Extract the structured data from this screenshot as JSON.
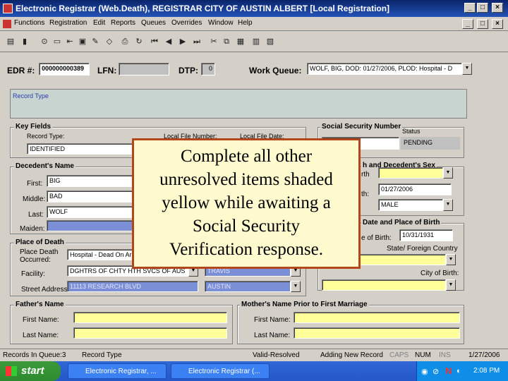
{
  "window": {
    "title": "Electronic Registrar (Web.Death), REGISTRAR   CITY OF AUSTIN   ALBERT   [Local Registration]"
  },
  "menu": [
    "Functions",
    "Registration",
    "Edit",
    "Reports",
    "Queues",
    "Overrides",
    "Window",
    "Help"
  ],
  "header": {
    "edr_label": "EDR #:",
    "edr_value": "000000000389",
    "lfn_label": "LFN:",
    "lfn_value": "",
    "dtp_label": "DTP:",
    "dtp_value": "0",
    "work_queue_label": "Work Queue:",
    "work_queue_value": "WOLF, BIG, DOD: 01/27/2006, PLOD: Hospital - D"
  },
  "record_type_label": "Record Type",
  "key_fields": {
    "title": "Key Fields",
    "record_type_label": "Record Type:",
    "record_type_value": "IDENTIFIED",
    "local_file_number_label": "Local File Number:",
    "local_file_date_label": "Local File Date:"
  },
  "ssn": {
    "title": "Social Security Number",
    "status_label": "Status",
    "status_value": "PENDING"
  },
  "decedent_name": {
    "title": "Decedent's Name",
    "first_label": "First:",
    "first_value": "BIG",
    "middle_label": "Middle:",
    "middle_value": "BAD",
    "last_label": "Last:",
    "last_value": "WOLF",
    "maiden_label": "Maiden:"
  },
  "birth_sex": {
    "title": "h and Decedent's Sex",
    "dob_partial_label": "rth",
    "dod_partial_label": "th:",
    "dod_value": "01/27/2006",
    "sex_value": "MALE"
  },
  "date_place_birth": {
    "title": "Date and Place of Birth",
    "dob_label": "e of Birth:",
    "dob_value": "10/31/1931",
    "state_label": "State/ Foreign Country",
    "city_label": "City of Birth:"
  },
  "place_of_death": {
    "title": "Place of Death",
    "place_label": "Place Death Occurred:",
    "place_value": "Hospital - Dead On Arr",
    "facility_label": "Facility:",
    "facility_value": "DGHTRS OF CHTY HTH SVCS OF AUS",
    "county_value": "TRAVIS",
    "street_label": "Street Address:",
    "street_value": "11113 RESEARCH BLVD",
    "city_value": "AUSTIN"
  },
  "father": {
    "title": "Father's Name",
    "first_label": "First Name:",
    "last_label": "Last Name:"
  },
  "mother": {
    "title": "Mother's Name Prior to First Marriage",
    "first_label": "First Name:",
    "last_label": "Last Name:"
  },
  "callout": {
    "line1": "Complete all other",
    "line2": "unresolved items shaded",
    "line3": "yellow while awaiting a",
    "line4": "Social Security",
    "line5": "Verification response."
  },
  "status_bar": {
    "records": "Records In Queue:3",
    "record_type": "Record Type",
    "valid": "Valid-Resolved",
    "adding": "Adding New Record",
    "caps": "CAPS",
    "num": "NUM",
    "ins": "INS",
    "date": "1/27/2006"
  },
  "taskbar": {
    "start": "start",
    "task1": "Electronic Registrar, ...",
    "task2": "Electronic Registrar (...",
    "clock": "2:08 PM"
  },
  "colors": {
    "title_bar": "#0a246a",
    "required_yellow": "#ffff99",
    "selected_blue": "#7b8fd6",
    "callout_border": "#b4461c",
    "taskbar": "#2457c7"
  }
}
